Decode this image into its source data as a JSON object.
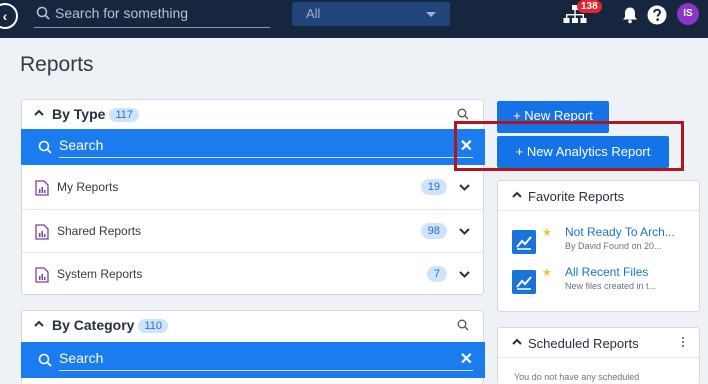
{
  "topbar": {
    "search_placeholder": "Search for something",
    "scope_value": "All",
    "notification_count": "138",
    "avatar_initials": "IS"
  },
  "page": {
    "title": "Reports"
  },
  "by_type": {
    "title": "By Type",
    "count": "117",
    "search_label": "Search",
    "items": [
      {
        "label": "My Reports",
        "count": "19"
      },
      {
        "label": "Shared Reports",
        "count": "98"
      },
      {
        "label": "System Reports",
        "count": "7"
      }
    ]
  },
  "by_category": {
    "title": "By Category",
    "count": "110",
    "search_label": "Search"
  },
  "actions": {
    "new_report": "+ New Report",
    "new_analytics_report": "+ New Analytics Report"
  },
  "favorites": {
    "title": "Favorite Reports",
    "items": [
      {
        "title": "Not Ready To Arch...",
        "subtitle": "By David Found on 20..."
      },
      {
        "title": "All Recent Files",
        "subtitle": "New files created in t..."
      }
    ]
  },
  "scheduled": {
    "title": "Scheduled Reports",
    "empty_message": "You do not have any scheduled"
  },
  "colors": {
    "topbar": "#16263f",
    "primary": "#1473e6",
    "highlight": "#b0161c",
    "avatar": "#8a36c9"
  }
}
